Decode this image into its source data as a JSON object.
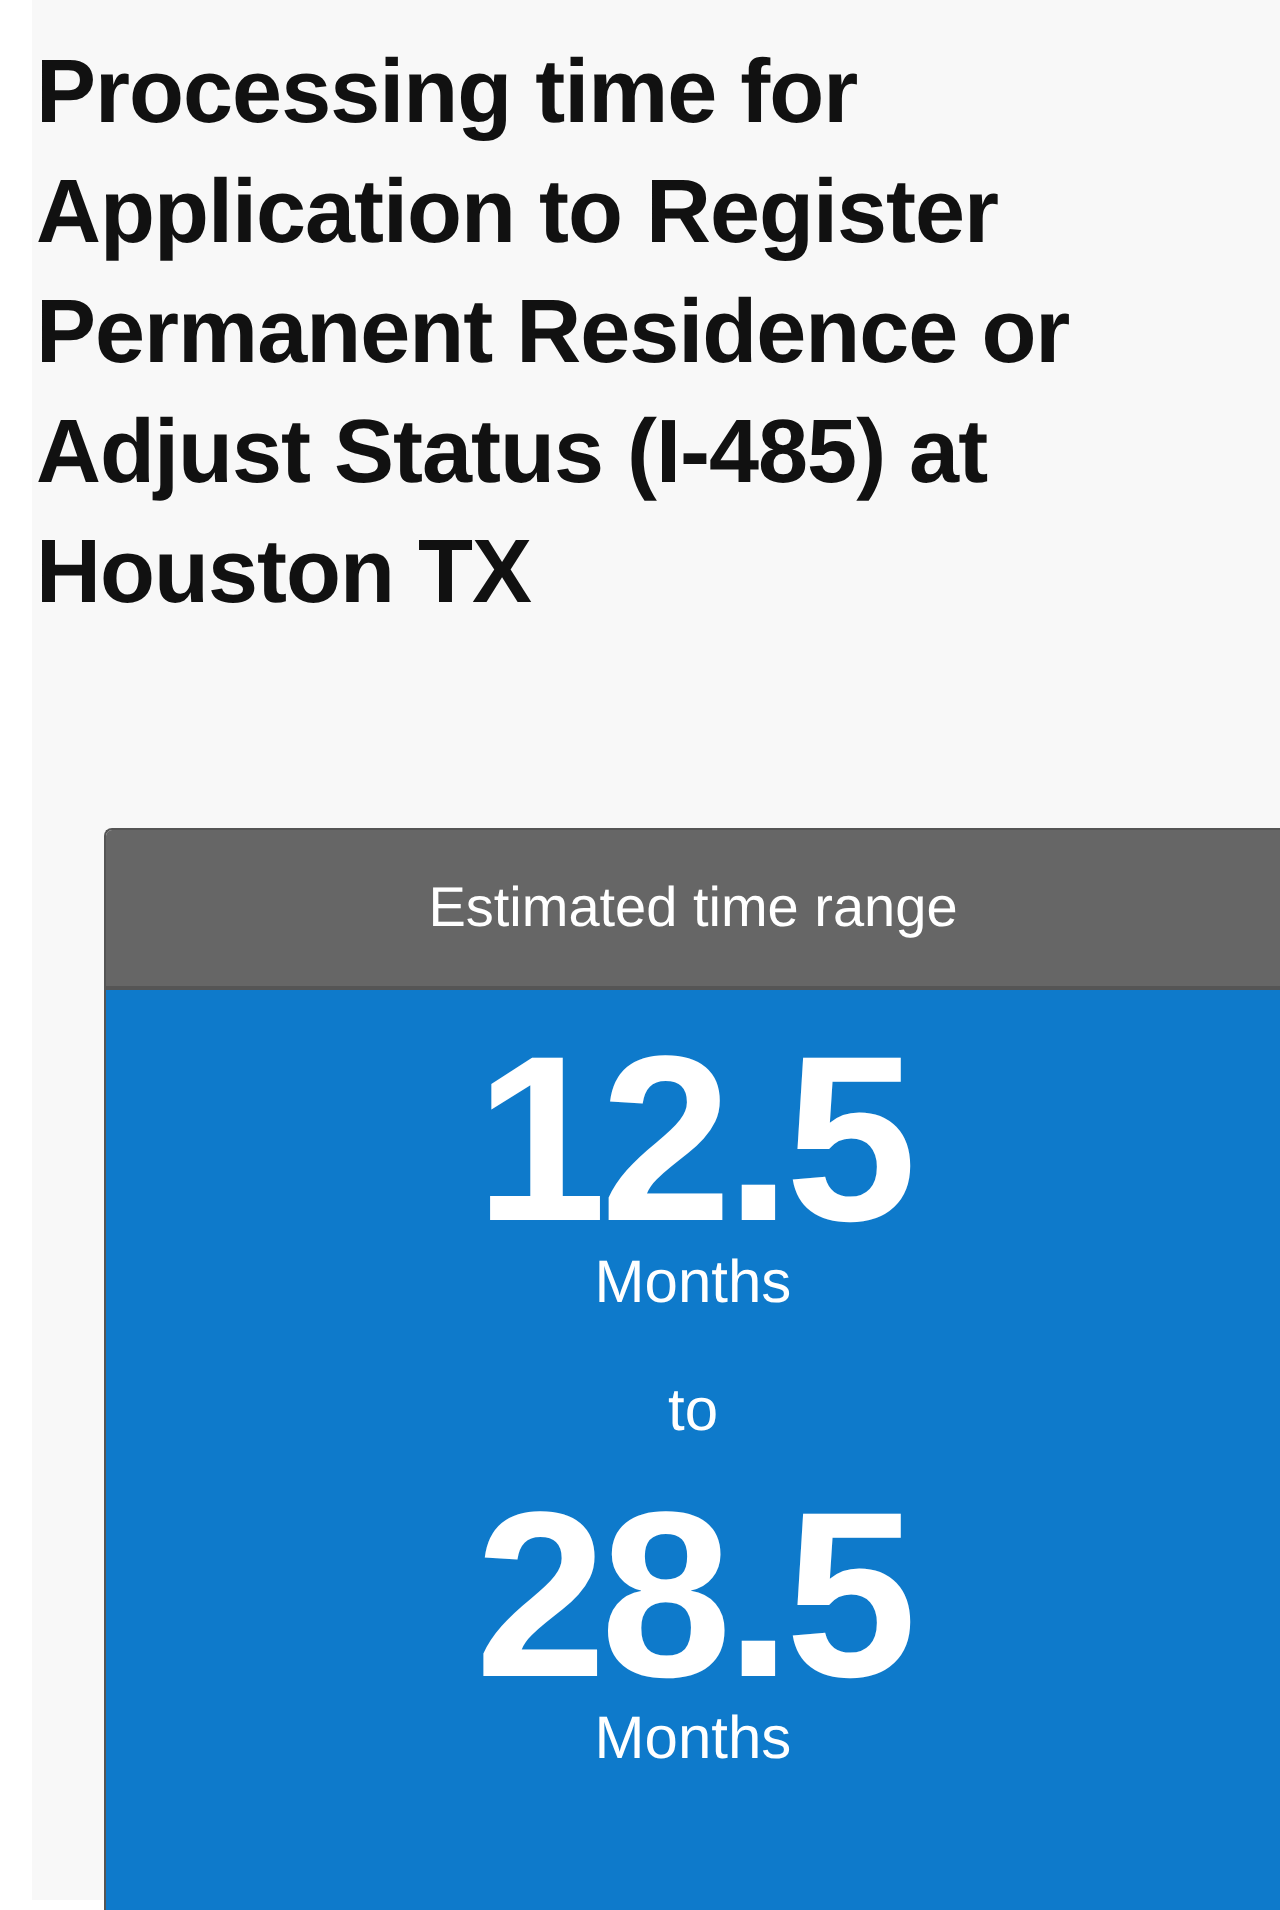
{
  "title": "Processing time for Application to Register Permanent Residence or Adjust Status (I-485) at Houston TX",
  "card": {
    "header": "Estimated time range",
    "low": {
      "value": "12.5",
      "unit": "Months"
    },
    "separator": "to",
    "high": {
      "value": "28.5",
      "unit": "Months"
    }
  }
}
